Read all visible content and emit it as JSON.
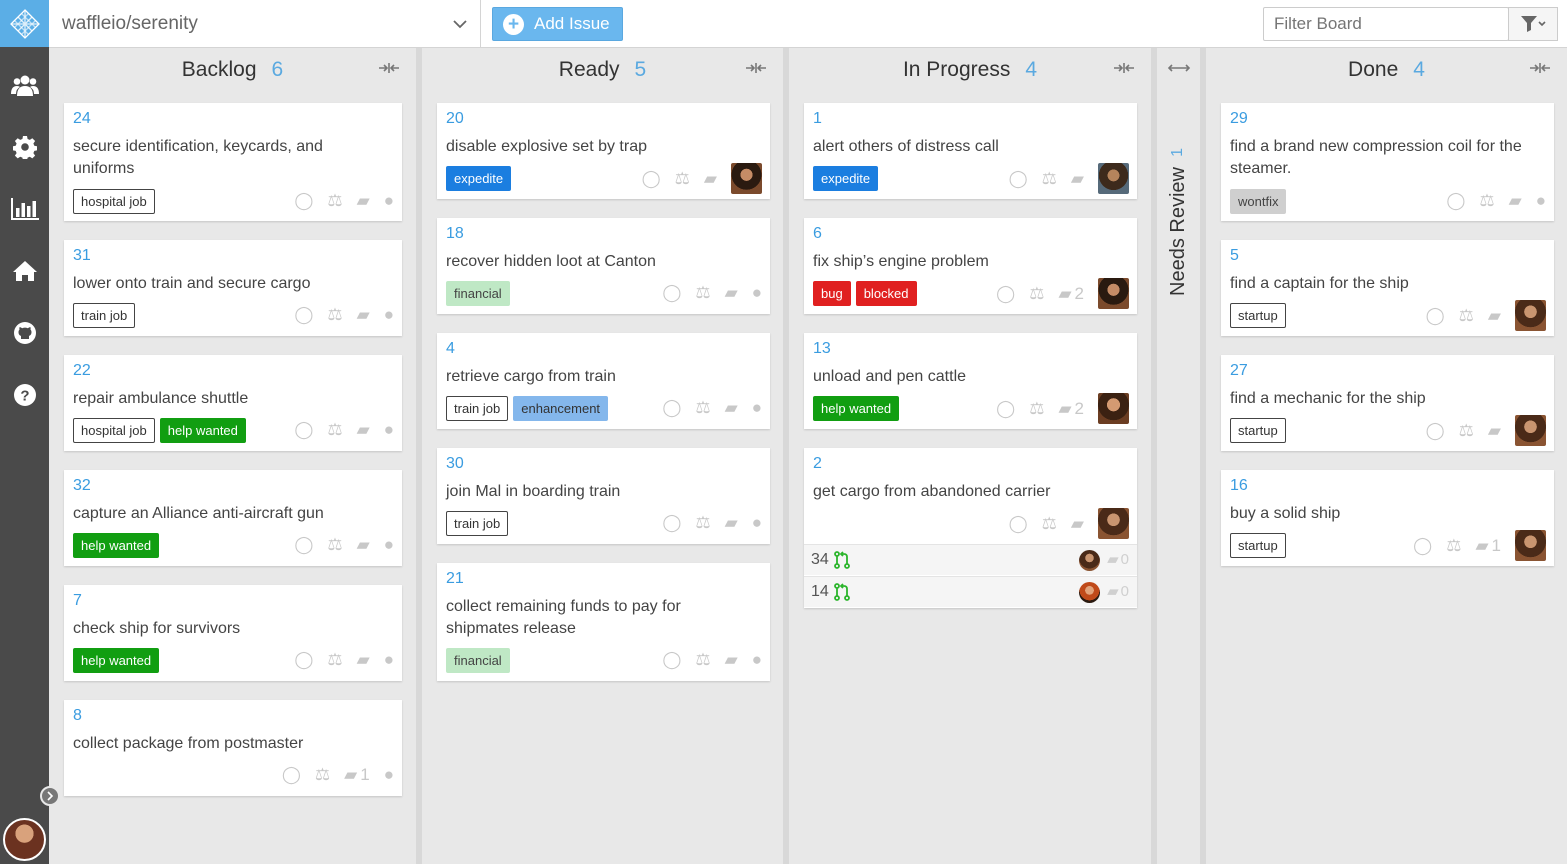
{
  "header": {
    "repo": "waffleio/serenity",
    "add_issue": "Add Issue",
    "filter_placeholder": "Filter Board"
  },
  "sidebar": {
    "items": [
      "team-icon",
      "settings-icon",
      "metrics-icon",
      "home-icon",
      "github-icon",
      "help-icon"
    ]
  },
  "columns": {
    "backlog": {
      "title": "Backlog",
      "count": "6"
    },
    "ready": {
      "title": "Ready",
      "count": "5"
    },
    "in_progress": {
      "title": "In Progress",
      "count": "4"
    },
    "needs_review": {
      "title": "Needs Review",
      "count": "1"
    },
    "done": {
      "title": "Done",
      "count": "4"
    }
  },
  "cards": {
    "b24": {
      "num": "24",
      "title": "secure identification, keycards, and uniforms",
      "labels": [
        "hospital job"
      ]
    },
    "b31": {
      "num": "31",
      "title": "lower onto train and secure cargo",
      "labels": [
        "train job"
      ]
    },
    "b22": {
      "num": "22",
      "title": "repair ambulance shuttle",
      "labels": [
        "hospital job",
        "help wanted"
      ]
    },
    "b32": {
      "num": "32",
      "title": "capture an Alliance anti-aircraft gun",
      "labels": [
        "help wanted"
      ]
    },
    "b7": {
      "num": "7",
      "title": "check ship for survivors",
      "labels": [
        "help wanted"
      ]
    },
    "b8": {
      "num": "8",
      "title": "collect package from postmaster",
      "comments": "1"
    },
    "r20": {
      "num": "20",
      "title": "disable explosive set by trap",
      "labels": [
        "expedite"
      ]
    },
    "r18": {
      "num": "18",
      "title": "recover hidden loot at Canton",
      "labels": [
        "financial"
      ]
    },
    "r4": {
      "num": "4",
      "title": "retrieve cargo from train",
      "labels": [
        "train job",
        "enhancement"
      ]
    },
    "r30": {
      "num": "30",
      "title": "join Mal in boarding train",
      "labels": [
        "train job"
      ]
    },
    "r21": {
      "num": "21",
      "title": "collect remaining funds to pay for shipmates release",
      "labels": [
        "financial"
      ]
    },
    "p1": {
      "num": "1",
      "title": "alert others of distress call",
      "labels": [
        "expedite"
      ]
    },
    "p6": {
      "num": "6",
      "title": "fix ship’s engine problem",
      "labels": [
        "bug",
        "blocked"
      ],
      "comments": "2"
    },
    "p13": {
      "num": "13",
      "title": "unload and pen cattle",
      "labels": [
        "help wanted"
      ],
      "comments": "2"
    },
    "p2": {
      "num": "2",
      "title": "get cargo from abandoned carrier",
      "prs": [
        {
          "num": "34",
          "comments": "0"
        },
        {
          "num": "14",
          "comments": "0"
        }
      ]
    },
    "d29": {
      "num": "29",
      "title": "find a brand new compression coil for the steamer.",
      "labels": [
        "wontfix"
      ]
    },
    "d5": {
      "num": "5",
      "title": "find a captain for the ship",
      "labels": [
        "startup"
      ]
    },
    "d27": {
      "num": "27",
      "title": "find a mechanic for the ship",
      "labels": [
        "startup"
      ]
    },
    "d16": {
      "num": "16",
      "title": "buy a solid ship",
      "labels": [
        "startup"
      ],
      "comments": "1"
    }
  },
  "colors": {
    "accent": "#5baee6",
    "help_wanted": "#119e11",
    "expedite": "#1b7ee0",
    "bug": "#e02020"
  }
}
